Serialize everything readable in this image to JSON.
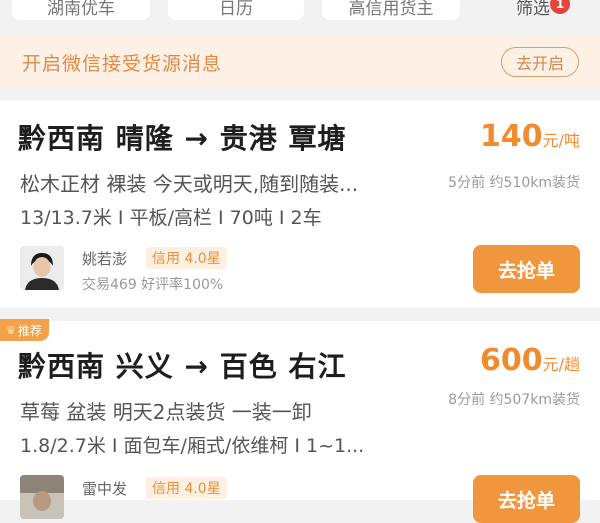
{
  "filters": [
    {
      "label": "湖南优车"
    },
    {
      "label": "日历"
    },
    {
      "label": "高信用货主"
    },
    {
      "label": "筛选",
      "badge": "1"
    }
  ],
  "notice": {
    "text": "开启微信接受货源消息",
    "button": "去开启"
  },
  "cards": [
    {
      "recommend": "",
      "route": "黔西南 晴隆 → 贵港 覃塘",
      "price_value": "140",
      "price_unit": "元/吨",
      "description": "松木正材 裸装 今天或明天,随到随装...",
      "meta": "5分前 约510km装货",
      "specs": "13/13.7米 I 平板/高栏 I 70吨 I 2车",
      "shipper": {
        "name": "姚若澎",
        "credit": "信用 4.0星",
        "stats": "交易469 好评率100%"
      },
      "action": "去抢单"
    },
    {
      "recommend": "推荐",
      "route": "黔西南 兴义 → 百色 右江",
      "price_value": "600",
      "price_unit": "元/趟",
      "description": "草莓 盆装 明天2点装货 一装一卸",
      "meta": "8分前 约507km装货",
      "specs": "1.8/2.7米 I 面包车/厢式/依维柯 I 1~1...",
      "shipper": {
        "name": "雷中发",
        "credit": "信用 4.0星",
        "stats": ""
      },
      "action": "去抢单"
    }
  ],
  "colors": {
    "accent": "#f0963c",
    "price": "#f08c2e",
    "notice_bg": "#fdf0e4",
    "badge": "#e6453a"
  },
  "icons": {
    "recommend": "crown-icon",
    "arrow": "right-arrow"
  }
}
